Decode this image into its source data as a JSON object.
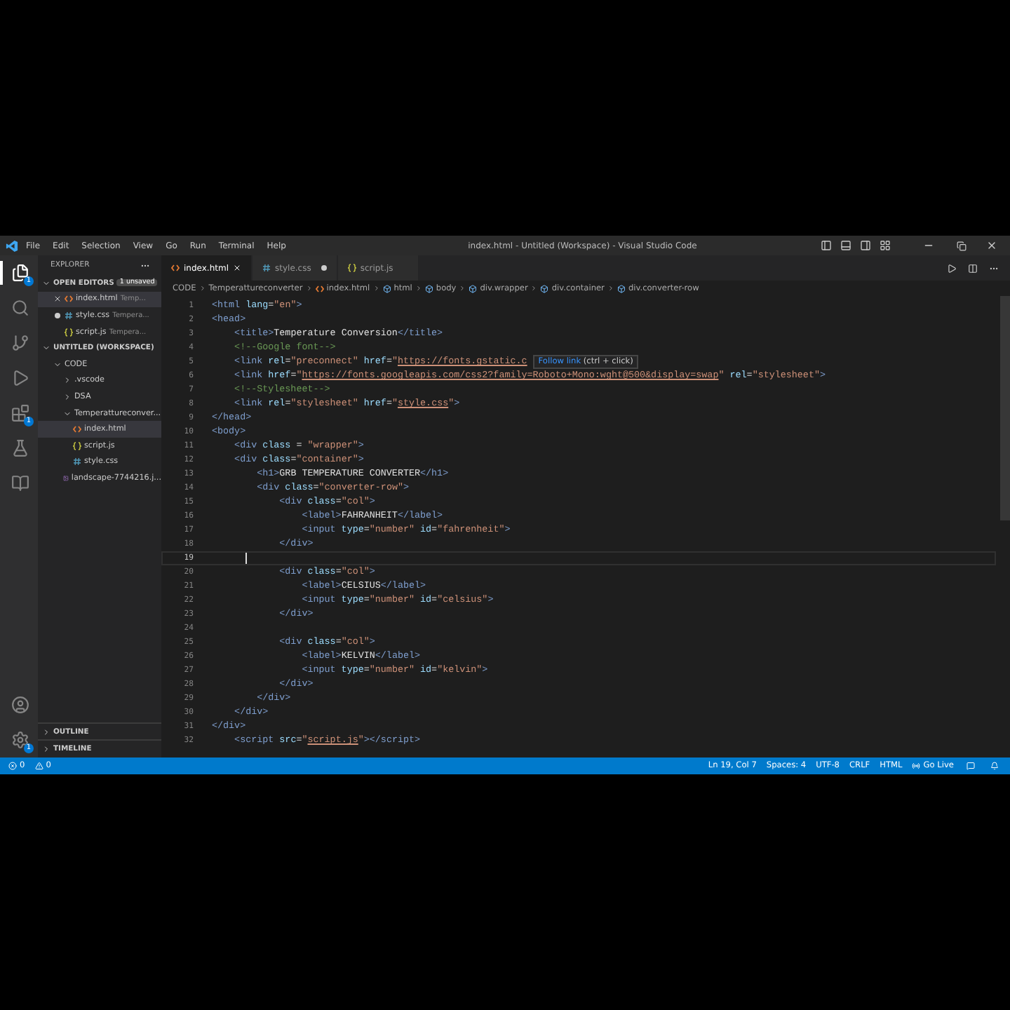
{
  "window": {
    "title": "index.html - Untitled (Workspace) - Visual Studio Code",
    "menu": [
      "File",
      "Edit",
      "Selection",
      "View",
      "Go",
      "Run",
      "Terminal",
      "Help"
    ]
  },
  "activity_bar": {
    "top": [
      {
        "kind": "explorer",
        "selected": true,
        "badge": "1"
      },
      {
        "kind": "search",
        "selected": false
      },
      {
        "kind": "source-control",
        "selected": false
      },
      {
        "kind": "run",
        "selected": false
      },
      {
        "kind": "extensions",
        "selected": false,
        "badge": "1"
      },
      {
        "kind": "testing",
        "selected": false
      },
      {
        "kind": "remote",
        "selected": false
      }
    ],
    "bottom": [
      {
        "kind": "account"
      },
      {
        "kind": "settings",
        "badge": "1"
      }
    ]
  },
  "sidebar": {
    "title": "EXPLORER",
    "open_editors": {
      "title": "OPEN EDITORS",
      "badge": "1 unsaved",
      "items": [
        {
          "label": "index.html",
          "detail": "Temp...",
          "kind": "html",
          "hovered": true,
          "dirty": false,
          "selected": true
        },
        {
          "label": "style.css",
          "detail": "Tempera...",
          "kind": "css",
          "hovered": false,
          "dirty": true,
          "selected": false
        },
        {
          "label": "script.js",
          "detail": "Tempera...",
          "kind": "js",
          "hovered": false,
          "dirty": false,
          "selected": false
        }
      ]
    },
    "workspace": {
      "title": "UNTITLED (WORKSPACE)",
      "tree": [
        {
          "label": "CODE",
          "kind": "folder",
          "expanded": true,
          "selected": false,
          "children": [
            {
              "label": ".vscode",
              "kind": "folder",
              "expanded": false,
              "selected": false
            },
            {
              "label": "DSA",
              "kind": "folder",
              "expanded": false,
              "selected": false
            },
            {
              "label": "Temperattureconver...",
              "kind": "folder",
              "expanded": true,
              "selected": false,
              "children": [
                {
                  "label": "index.html",
                  "kind": "html",
                  "selected": true
                },
                {
                  "label": "script.js",
                  "kind": "js",
                  "selected": false
                },
                {
                  "label": "style.css",
                  "kind": "css",
                  "selected": false
                }
              ]
            },
            {
              "label": "landscape-7744216.j...",
              "kind": "image",
              "selected": false
            }
          ]
        }
      ]
    },
    "panels": [
      "OUTLINE",
      "TIMELINE"
    ]
  },
  "tabs": [
    {
      "label": "index.html",
      "kind": "html",
      "selected": true,
      "dirty": false
    },
    {
      "label": "style.css",
      "kind": "css",
      "selected": false,
      "dirty": true
    },
    {
      "label": "script.js",
      "kind": "js",
      "selected": false,
      "dirty": false
    }
  ],
  "breadcrumb": [
    {
      "label": "CODE",
      "kind": "folder"
    },
    {
      "label": "Temperattureconverter",
      "kind": "folder"
    },
    {
      "label": "index.html",
      "kind": "html"
    },
    {
      "label": "html",
      "kind": "element"
    },
    {
      "label": "body",
      "kind": "element"
    },
    {
      "label": "div.wrapper",
      "kind": "element"
    },
    {
      "label": "div.container",
      "kind": "element"
    },
    {
      "label": "div.converter-row",
      "kind": "element"
    }
  ],
  "code": [
    {
      "n": "1",
      "current": false,
      "tokens": [
        {
          "kind": "tag",
          "text": "<html"
        },
        {
          "kind": "attr",
          "text": " lang"
        },
        {
          "kind": "eq",
          "text": "="
        },
        {
          "kind": "str",
          "text": "\"en\""
        },
        {
          "kind": "tag",
          "text": ">"
        }
      ]
    },
    {
      "n": "2",
      "current": false,
      "tokens": [
        {
          "kind": "tag",
          "text": "<head>"
        }
      ]
    },
    {
      "n": "3",
      "current": false,
      "tokens": [
        {
          "kind": "tag",
          "text": "    <title>"
        },
        {
          "kind": "text",
          "text": "Temperature Conversion"
        },
        {
          "kind": "tag",
          "text": "</title>"
        }
      ]
    },
    {
      "n": "4",
      "current": false,
      "tokens": [
        {
          "kind": "comment",
          "text": "    <!--Google font-->"
        }
      ]
    },
    {
      "n": "5",
      "current": false,
      "tokens": [
        {
          "kind": "tag",
          "text": "    <link"
        },
        {
          "kind": "attr",
          "text": " rel"
        },
        {
          "kind": "eq",
          "text": "="
        },
        {
          "kind": "str",
          "text": "\"preconnect\""
        },
        {
          "kind": "attr",
          "text": " href"
        },
        {
          "kind": "eq",
          "text": "="
        },
        {
          "kind": "str",
          "text": "\""
        },
        {
          "kind": "link",
          "text": "https://fonts.gstatic.c"
        }
      ],
      "tooltip": {
        "link": "Follow link",
        "hint": "(ctrl + click)"
      }
    },
    {
      "n": "6",
      "current": false,
      "tokens": [
        {
          "kind": "tag",
          "text": "    <link"
        },
        {
          "kind": "attr",
          "text": " href"
        },
        {
          "kind": "eq",
          "text": "="
        },
        {
          "kind": "str",
          "text": "\""
        },
        {
          "kind": "link",
          "text": "https://fonts.googleapis.com/css2?family=Roboto+Mono:wght@500&display=swap"
        },
        {
          "kind": "str",
          "text": "\""
        },
        {
          "kind": "attr",
          "text": " rel"
        },
        {
          "kind": "eq",
          "text": "="
        },
        {
          "kind": "str",
          "text": "\"stylesheet\""
        },
        {
          "kind": "tag",
          "text": ">"
        }
      ]
    },
    {
      "n": "7",
      "current": false,
      "tokens": [
        {
          "kind": "comment",
          "text": "    <!--Stylesheet-->"
        }
      ]
    },
    {
      "n": "8",
      "current": false,
      "tokens": [
        {
          "kind": "tag",
          "text": "    <link"
        },
        {
          "kind": "attr",
          "text": " rel"
        },
        {
          "kind": "eq",
          "text": "="
        },
        {
          "kind": "str",
          "text": "\"stylesheet\""
        },
        {
          "kind": "attr",
          "text": " href"
        },
        {
          "kind": "eq",
          "text": "="
        },
        {
          "kind": "str",
          "text": "\""
        },
        {
          "kind": "link",
          "text": "style.css"
        },
        {
          "kind": "str",
          "text": "\""
        },
        {
          "kind": "tag",
          "text": ">"
        }
      ]
    },
    {
      "n": "9",
      "current": false,
      "tokens": [
        {
          "kind": "tag",
          "text": "</head>"
        }
      ]
    },
    {
      "n": "10",
      "current": false,
      "tokens": [
        {
          "kind": "tag",
          "text": "<body>"
        }
      ]
    },
    {
      "n": "11",
      "current": false,
      "tokens": [
        {
          "kind": "tag",
          "text": "    <div"
        },
        {
          "kind": "attr",
          "text": " class"
        },
        {
          "kind": "eq",
          "text": " = "
        },
        {
          "kind": "str",
          "text": "\"wrapper\""
        },
        {
          "kind": "tag",
          "text": ">"
        }
      ]
    },
    {
      "n": "12",
      "current": false,
      "tokens": [
        {
          "kind": "tag",
          "text": "    <div"
        },
        {
          "kind": "attr",
          "text": " class"
        },
        {
          "kind": "eq",
          "text": "="
        },
        {
          "kind": "str",
          "text": "\"container\""
        },
        {
          "kind": "tag",
          "text": ">"
        }
      ]
    },
    {
      "n": "13",
      "current": false,
      "tokens": [
        {
          "kind": "tag",
          "text": "        <h1>"
        },
        {
          "kind": "text",
          "text": "GRB TEMPERATURE CONVERTER"
        },
        {
          "kind": "tag",
          "text": "</h1>"
        }
      ]
    },
    {
      "n": "14",
      "current": false,
      "tokens": [
        {
          "kind": "tag",
          "text": "        <div"
        },
        {
          "kind": "attr",
          "text": " class"
        },
        {
          "kind": "eq",
          "text": "="
        },
        {
          "kind": "str",
          "text": "\"converter-row\""
        },
        {
          "kind": "tag",
          "text": ">"
        }
      ]
    },
    {
      "n": "15",
      "current": false,
      "tokens": [
        {
          "kind": "tag",
          "text": "            <div"
        },
        {
          "kind": "attr",
          "text": " class"
        },
        {
          "kind": "eq",
          "text": "="
        },
        {
          "kind": "str",
          "text": "\"col\""
        },
        {
          "kind": "tag",
          "text": ">"
        }
      ]
    },
    {
      "n": "16",
      "current": false,
      "tokens": [
        {
          "kind": "tag",
          "text": "                <label>"
        },
        {
          "kind": "text",
          "text": "FAHRANHEIT"
        },
        {
          "kind": "tag",
          "text": "</label>"
        }
      ]
    },
    {
      "n": "17",
      "current": false,
      "tokens": [
        {
          "kind": "tag",
          "text": "                <input"
        },
        {
          "kind": "attr",
          "text": " type"
        },
        {
          "kind": "eq",
          "text": "="
        },
        {
          "kind": "str",
          "text": "\"number\""
        },
        {
          "kind": "attr",
          "text": " id"
        },
        {
          "kind": "eq",
          "text": "="
        },
        {
          "kind": "str",
          "text": "\"fahrenheit\""
        },
        {
          "kind": "tag",
          "text": ">"
        }
      ]
    },
    {
      "n": "18",
      "current": false,
      "tokens": [
        {
          "kind": "tag",
          "text": "            </div>"
        }
      ]
    },
    {
      "n": "19",
      "current": true
    },
    {
      "n": "20",
      "current": false,
      "tokens": [
        {
          "kind": "tag",
          "text": "            <div"
        },
        {
          "kind": "attr",
          "text": " class"
        },
        {
          "kind": "eq",
          "text": "="
        },
        {
          "kind": "str",
          "text": "\"col\""
        },
        {
          "kind": "tag",
          "text": ">"
        }
      ]
    },
    {
      "n": "21",
      "current": false,
      "tokens": [
        {
          "kind": "tag",
          "text": "                <label>"
        },
        {
          "kind": "text",
          "text": "CELSIUS"
        },
        {
          "kind": "tag",
          "text": "</label>"
        }
      ]
    },
    {
      "n": "22",
      "current": false,
      "tokens": [
        {
          "kind": "tag",
          "text": "                <input"
        },
        {
          "kind": "attr",
          "text": " type"
        },
        {
          "kind": "eq",
          "text": "="
        },
        {
          "kind": "str",
          "text": "\"number\""
        },
        {
          "kind": "attr",
          "text": " id"
        },
        {
          "kind": "eq",
          "text": "="
        },
        {
          "kind": "str",
          "text": "\"celsius\""
        },
        {
          "kind": "tag",
          "text": ">"
        }
      ]
    },
    {
      "n": "23",
      "current": false,
      "tokens": [
        {
          "kind": "tag",
          "text": "            </div>"
        }
      ]
    },
    {
      "n": "24",
      "current": false
    },
    {
      "n": "25",
      "current": false,
      "tokens": [
        {
          "kind": "tag",
          "text": "            <div"
        },
        {
          "kind": "attr",
          "text": " class"
        },
        {
          "kind": "eq",
          "text": "="
        },
        {
          "kind": "str",
          "text": "\"col\""
        },
        {
          "kind": "tag",
          "text": ">"
        }
      ]
    },
    {
      "n": "26",
      "current": false,
      "tokens": [
        {
          "kind": "tag",
          "text": "                <label>"
        },
        {
          "kind": "text",
          "text": "KELVIN"
        },
        {
          "kind": "tag",
          "text": "</label>"
        }
      ]
    },
    {
      "n": "27",
      "current": false,
      "tokens": [
        {
          "kind": "tag",
          "text": "                <input"
        },
        {
          "kind": "attr",
          "text": " type"
        },
        {
          "kind": "eq",
          "text": "="
        },
        {
          "kind": "str",
          "text": "\"number\""
        },
        {
          "kind": "attr",
          "text": " id"
        },
        {
          "kind": "eq",
          "text": "="
        },
        {
          "kind": "str",
          "text": "\"kelvin\""
        },
        {
          "kind": "tag",
          "text": ">"
        }
      ]
    },
    {
      "n": "28",
      "current": false,
      "tokens": [
        {
          "kind": "tag",
          "text": "            </div>"
        }
      ]
    },
    {
      "n": "29",
      "current": false,
      "tokens": [
        {
          "kind": "tag",
          "text": "        </div>"
        }
      ]
    },
    {
      "n": "30",
      "current": false,
      "tokens": [
        {
          "kind": "tag",
          "text": "    </div>"
        }
      ]
    },
    {
      "n": "31",
      "current": false,
      "tokens": [
        {
          "kind": "tag",
          "text": "</div>"
        }
      ]
    },
    {
      "n": "32",
      "current": false,
      "tokens": [
        {
          "kind": "tag",
          "text": "    <script"
        },
        {
          "kind": "attr",
          "text": " src"
        },
        {
          "kind": "eq",
          "text": "="
        },
        {
          "kind": "str",
          "text": "\""
        },
        {
          "kind": "link",
          "text": "script.js"
        },
        {
          "kind": "str",
          "text": "\""
        },
        {
          "kind": "tag",
          "text": "></script>"
        }
      ]
    }
  ],
  "status_bar": {
    "left": [
      {
        "kind": "errors",
        "text": "0"
      },
      {
        "kind": "warnings",
        "text": "0"
      }
    ],
    "right": [
      {
        "kind": "text",
        "text": "Ln 19, Col 7"
      },
      {
        "kind": "text",
        "text": "Spaces: 4"
      },
      {
        "kind": "text",
        "text": "UTF-8"
      },
      {
        "kind": "text",
        "text": "CRLF"
      },
      {
        "kind": "text",
        "text": "HTML"
      },
      {
        "kind": "golive",
        "text": "Go Live"
      },
      {
        "kind": "feedback"
      },
      {
        "kind": "bell"
      }
    ]
  }
}
